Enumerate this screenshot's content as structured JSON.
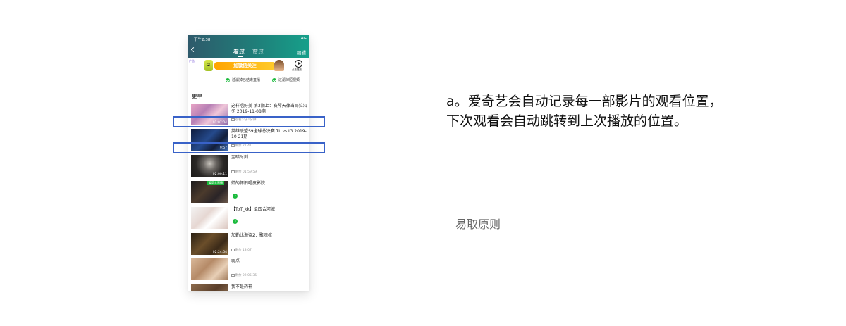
{
  "phone": {
    "status": {
      "time": "下午2:38",
      "right": "4G"
    },
    "header": {
      "tab_watched": "看过",
      "tab_liked": "赞过",
      "edit": "编辑"
    },
    "ad": {
      "tag": "广告",
      "logo_text": "2",
      "banner_text": "加微信关注",
      "play_label": "点击播放"
    },
    "filters": {
      "live": "过滤掉已结束直播",
      "short": "过滤掉短视频"
    },
    "section": "更早",
    "items": [
      {
        "title": "这样唱好美 第3期上：赛琴天律当局拉沼冬 2019-11-08期",
        "meta": "观看少于1分钟",
        "thumb_time": "01:07:04"
      },
      {
        "title": "英雄联盟S9全球总决赛 TL vs IG 2019-10-21期",
        "meta": "剩余 21:41",
        "thumb_time": "9:57"
      },
      {
        "title": "至暗时刻",
        "meta": "剩余 01:59:59",
        "thumb_time": "02:00:11"
      },
      {
        "title": "帅的怀旧唱皮影院",
        "live": "爱奇艺直播"
      },
      {
        "title": "【ToT_kk】单四合河城"
      },
      {
        "title": "加勒比海盗2：聚魂棺",
        "meta": "剩余 13:07",
        "thumb_time": "02:24:54"
      },
      {
        "title": "弱点",
        "meta": "剩余 02:05:35"
      },
      {
        "title": "我不是药神"
      }
    ]
  },
  "description": "a。爱奇艺会自动记录每一部影片的观看位置，下次观看会自动跳转到上次播放的位置。",
  "principle": "易取原则",
  "colors": {
    "accent": "#1cbb3e",
    "highlight": "#3962c8",
    "header_from": "#2e5a6b",
    "header_to": "#16a08a"
  }
}
